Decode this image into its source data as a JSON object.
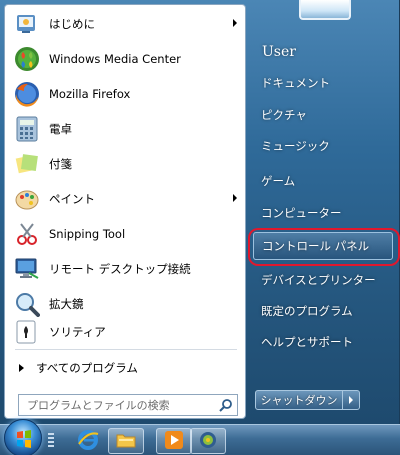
{
  "left_programs": [
    {
      "label": "はじめに",
      "icon": "getting-started-icon",
      "has_submenu": true
    },
    {
      "label": "Windows Media Center",
      "icon": "media-center-icon",
      "has_submenu": false
    },
    {
      "label": "Mozilla Firefox",
      "icon": "firefox-icon",
      "has_submenu": false
    },
    {
      "label": "電卓",
      "icon": "calculator-icon",
      "has_submenu": false
    },
    {
      "label": "付箋",
      "icon": "sticky-notes-icon",
      "has_submenu": false
    },
    {
      "label": "ペイント",
      "icon": "paint-icon",
      "has_submenu": true
    },
    {
      "label": "Snipping Tool",
      "icon": "snipping-tool-icon",
      "has_submenu": false
    },
    {
      "label": "リモート デスクトップ接続",
      "icon": "remote-desktop-icon",
      "has_submenu": false
    },
    {
      "label": "拡大鏡",
      "icon": "magnifier-icon",
      "has_submenu": false
    },
    {
      "label": "ソリティア",
      "icon": "solitaire-icon",
      "has_submenu": false
    }
  ],
  "all_programs_label": "すべてのプログラム",
  "search": {
    "placeholder": "プログラムとファイルの検索"
  },
  "user": {
    "name": "User"
  },
  "right_items": [
    {
      "label": "ドキュメント"
    },
    {
      "label": "ピクチャ"
    },
    {
      "label": "ミュージック"
    },
    {
      "label": "ゲーム"
    },
    {
      "label": "コンピューター"
    },
    {
      "label": "コントロール パネル",
      "highlighted": true
    },
    {
      "label": "デバイスとプリンター"
    },
    {
      "label": "既定のプログラム"
    },
    {
      "label": "ヘルプとサポート"
    }
  ],
  "shutdown_label": "シャットダウン",
  "colors": {
    "highlight_ring": "#e0182d",
    "menu_blue": "#2f6a99"
  }
}
